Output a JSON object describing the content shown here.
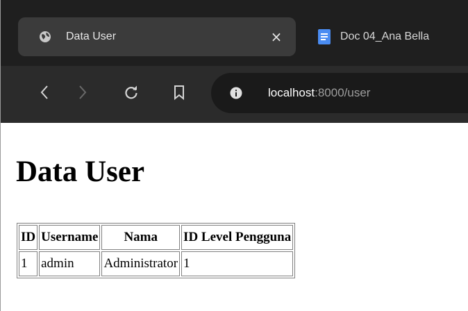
{
  "browser": {
    "active_tab": {
      "title": "Data User",
      "icon": "globe-icon",
      "close": "×"
    },
    "inactive_tab": {
      "title": "Doc 04_Ana Bella",
      "icon": "docs-icon"
    },
    "address": {
      "host": "localhost",
      "rest": ":8000/user"
    }
  },
  "page": {
    "heading": "Data User",
    "table": {
      "headers": [
        "ID",
        "Username",
        "Nama",
        "ID Level Pengguna"
      ],
      "rows": [
        [
          "1",
          "admin",
          "Administrator",
          "1"
        ]
      ]
    }
  }
}
